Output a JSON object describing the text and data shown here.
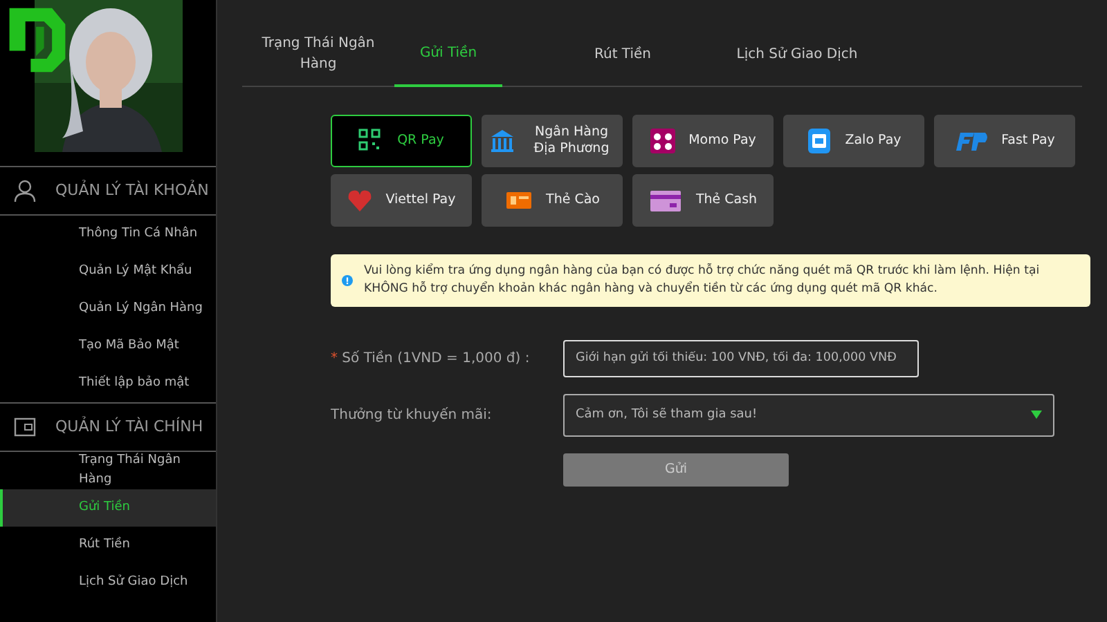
{
  "sidebar": {
    "sections": [
      {
        "title": "QUẢN LÝ TÀI KHOẢN",
        "kind": "user",
        "items": [
          {
            "label": "Thông Tin Cá Nhân",
            "selected": false
          },
          {
            "label": "Quản Lý Mật Khẩu",
            "selected": false
          },
          {
            "label": "Quản Lý Ngân Hàng",
            "selected": false
          },
          {
            "label": "Tạo Mã Bảo Mật",
            "selected": false
          },
          {
            "label": "Thiết lập bảo mật",
            "selected": false
          }
        ]
      },
      {
        "title": "QUẢN LÝ TÀI CHÍNH",
        "kind": "wallet",
        "items": [
          {
            "label": "Trạng Thái Ngân Hàng",
            "selected": false
          },
          {
            "label": "Gửi Tiền",
            "selected": true
          },
          {
            "label": "Rút Tiền",
            "selected": false
          },
          {
            "label": "Lịch Sử Giao Dịch",
            "selected": false
          }
        ]
      }
    ]
  },
  "tabs": [
    {
      "label": "Trạng Thái Ngân Hàng",
      "selected": false
    },
    {
      "label": "Gửi Tiền",
      "selected": true
    },
    {
      "label": "Rút Tiền",
      "selected": false
    },
    {
      "label": "Lịch Sử Giao Dịch",
      "selected": false
    }
  ],
  "methods": [
    {
      "label": "QR Pay",
      "kind": "qr",
      "selected": true
    },
    {
      "label": "Ngân Hàng Địa Phương",
      "kind": "bank",
      "selected": false
    },
    {
      "label": "Momo Pay",
      "kind": "momo",
      "selected": false
    },
    {
      "label": "Zalo Pay",
      "kind": "zalo",
      "selected": false
    },
    {
      "label": "Fast Pay",
      "kind": "fastpay",
      "selected": false
    },
    {
      "label": "Viettel Pay",
      "kind": "viettel",
      "selected": false
    },
    {
      "label": "Thẻ Cào",
      "kind": "card",
      "selected": false
    },
    {
      "label": "Thẻ Cash",
      "kind": "cash",
      "selected": false
    }
  ],
  "notice": "Vui lòng kiểm tra ứng dụng ngân hàng của bạn có được hỗ trợ chức năng quét mã QR trước khi làm lệnh. Hiện tại KHÔNG hỗ trợ chuyển khoản khác ngân hàng và chuyển tiền từ các ứng dụng quét mã QR khác.",
  "amount": {
    "required_mark": "*",
    "label": "Số Tiền (1VND = 1,000 đ) :",
    "placeholder": "Giới hạn gửi tối thiểu: 100 VNĐ, tối đa: 100,000 VNĐ"
  },
  "promo": {
    "label": "Thưởng từ khuyến mãi:",
    "value": "Cảm ơn, Tôi sẽ tham gia sau!"
  },
  "submit": "Gửi"
}
